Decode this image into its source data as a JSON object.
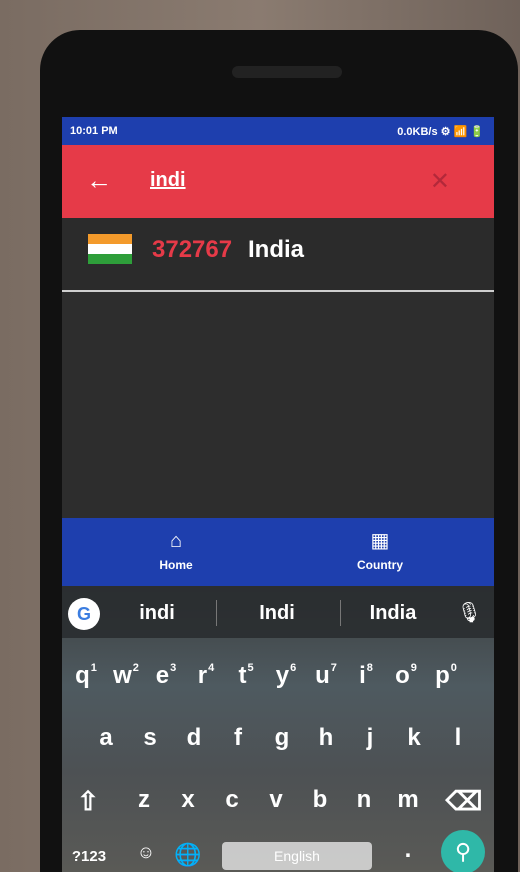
{
  "status_bar": {
    "time": "10:01 PM",
    "indicators": "0.0KB/s ⚙ 📶 🔋"
  },
  "search": {
    "back_icon": "←",
    "query": "indi",
    "clear_icon": "✕"
  },
  "results": [
    {
      "count": "372767",
      "country": "India"
    }
  ],
  "bottom_nav": {
    "home": "Home",
    "country": "Country"
  },
  "keyboard": {
    "suggestions": [
      "indi",
      "Indi",
      "India"
    ],
    "row1": [
      "q",
      "w",
      "e",
      "r",
      "t",
      "y",
      "u",
      "i",
      "o",
      "p"
    ],
    "row1_hints": [
      "1",
      "2",
      "3",
      "4",
      "5",
      "6",
      "7",
      "8",
      "9",
      "0"
    ],
    "row2": [
      "a",
      "s",
      "d",
      "f",
      "g",
      "h",
      "j",
      "k",
      "l"
    ],
    "row3": [
      "z",
      "x",
      "c",
      "v",
      "b",
      "n",
      "m"
    ],
    "numbers_key": "?123",
    "space_label": "English"
  }
}
